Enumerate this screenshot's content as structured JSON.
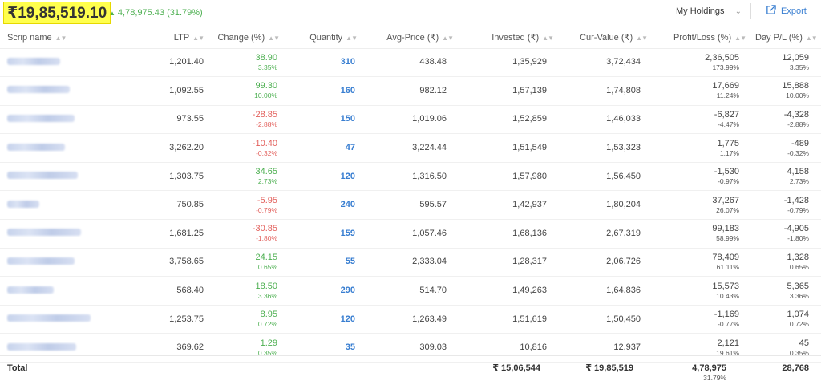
{
  "header": {
    "total_value": "₹19,85,519.10",
    "day_change_arrow": "▲",
    "day_change": "4,78,975.43 (31.79%)",
    "holdings_select": "My Holdings",
    "export_label": "Export"
  },
  "columns": [
    {
      "label": "Scrip name",
      "sort": "▲▼"
    },
    {
      "label": "LTP",
      "sort": "▲▼"
    },
    {
      "label": "Change (%)",
      "sort": "▲▼"
    },
    {
      "label": "Quantity",
      "sort": "▲▼"
    },
    {
      "label": "Avg-Price (₹)",
      "sort": "▲▼"
    },
    {
      "label": "Invested (₹)",
      "sort": "▲▼"
    },
    {
      "label": "Cur-Value (₹)",
      "sort": "▲▼"
    },
    {
      "label": "Profit/Loss (%)",
      "sort": "▲▼"
    },
    {
      "label": "Day P/L (%)",
      "sort": "▲▼"
    }
  ],
  "rows": [
    {
      "ltp": "1,201.40",
      "change": "38.90",
      "change_pct": "3.35%",
      "dir": "pos",
      "qty": "310",
      "avg": "438.48",
      "invested": "1,35,929",
      "cur": "3,72,434",
      "pl": "2,36,505",
      "pl_pct": "173.99%",
      "day_pl": "12,059",
      "day_pl_pct": "3.35%"
    },
    {
      "ltp": "1,092.55",
      "change": "99.30",
      "change_pct": "10.00%",
      "dir": "pos",
      "qty": "160",
      "avg": "982.12",
      "invested": "1,57,139",
      "cur": "1,74,808",
      "pl": "17,669",
      "pl_pct": "11.24%",
      "day_pl": "15,888",
      "day_pl_pct": "10.00%"
    },
    {
      "ltp": "973.55",
      "change": "-28.85",
      "change_pct": "-2.88%",
      "dir": "neg",
      "qty": "150",
      "avg": "1,019.06",
      "invested": "1,52,859",
      "cur": "1,46,033",
      "pl": "-6,827",
      "pl_pct": "-4.47%",
      "day_pl": "-4,328",
      "day_pl_pct": "-2.88%"
    },
    {
      "ltp": "3,262.20",
      "change": "-10.40",
      "change_pct": "-0.32%",
      "dir": "neg",
      "qty": "47",
      "avg": "3,224.44",
      "invested": "1,51,549",
      "cur": "1,53,323",
      "pl": "1,775",
      "pl_pct": "1.17%",
      "day_pl": "-489",
      "day_pl_pct": "-0.32%"
    },
    {
      "ltp": "1,303.75",
      "change": "34.65",
      "change_pct": "2.73%",
      "dir": "pos",
      "qty": "120",
      "avg": "1,316.50",
      "invested": "1,57,980",
      "cur": "1,56,450",
      "pl": "-1,530",
      "pl_pct": "-0.97%",
      "day_pl": "4,158",
      "day_pl_pct": "2.73%"
    },
    {
      "ltp": "750.85",
      "change": "-5.95",
      "change_pct": "-0.79%",
      "dir": "neg",
      "qty": "240",
      "avg": "595.57",
      "invested": "1,42,937",
      "cur": "1,80,204",
      "pl": "37,267",
      "pl_pct": "26.07%",
      "day_pl": "-1,428",
      "day_pl_pct": "-0.79%"
    },
    {
      "ltp": "1,681.25",
      "change": "-30.85",
      "change_pct": "-1.80%",
      "dir": "neg",
      "qty": "159",
      "avg": "1,057.46",
      "invested": "1,68,136",
      "cur": "2,67,319",
      "pl": "99,183",
      "pl_pct": "58.99%",
      "day_pl": "-4,905",
      "day_pl_pct": "-1.80%"
    },
    {
      "ltp": "3,758.65",
      "change": "24.15",
      "change_pct": "0.65%",
      "dir": "pos",
      "qty": "55",
      "avg": "2,333.04",
      "invested": "1,28,317",
      "cur": "2,06,726",
      "pl": "78,409",
      "pl_pct": "61.11%",
      "day_pl": "1,328",
      "day_pl_pct": "0.65%"
    },
    {
      "ltp": "568.40",
      "change": "18.50",
      "change_pct": "3.36%",
      "dir": "pos",
      "qty": "290",
      "avg": "514.70",
      "invested": "1,49,263",
      "cur": "1,64,836",
      "pl": "15,573",
      "pl_pct": "10.43%",
      "day_pl": "5,365",
      "day_pl_pct": "3.36%"
    },
    {
      "ltp": "1,253.75",
      "change": "8.95",
      "change_pct": "0.72%",
      "dir": "pos",
      "qty": "120",
      "avg": "1,263.49",
      "invested": "1,51,619",
      "cur": "1,50,450",
      "pl": "-1,169",
      "pl_pct": "-0.77%",
      "day_pl": "1,074",
      "day_pl_pct": "0.72%"
    },
    {
      "ltp": "369.62",
      "change": "1.29",
      "change_pct": "0.35%",
      "dir": "pos",
      "qty": "35",
      "avg": "309.03",
      "invested": "10,816",
      "cur": "12,937",
      "pl": "2,121",
      "pl_pct": "19.61%",
      "day_pl": "45",
      "day_pl_pct": "0.35%"
    }
  ],
  "totals": {
    "label": "Total",
    "invested": "₹ 15,06,544",
    "cur": "₹ 19,85,519",
    "pl": "4,78,975",
    "pl_pct": "31.79%",
    "day_pl": "28,768"
  },
  "colors": {
    "positive": "#4caf50",
    "negative": "#e25f5b",
    "accent": "#387ed1",
    "highlight": "#ffff4d"
  },
  "icons": {
    "export": "external-link-icon",
    "select": "chevron-down-icon",
    "day_change": "arrow-up-icon",
    "sort": "sort-icon"
  }
}
